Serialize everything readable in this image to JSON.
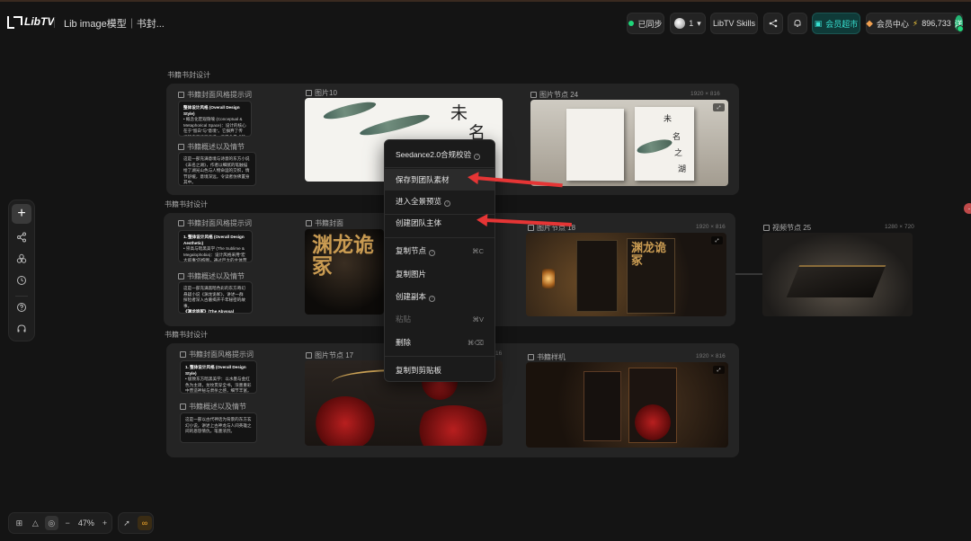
{
  "header": {
    "logo_text": "LibTV",
    "project_title": "Lib image模型｜书封...",
    "sync_label": "已同步",
    "collab_count": "1",
    "skills_label": "LibTV Skills",
    "vip_label": "会员超市",
    "member_center_label": "会员中心",
    "credits": "896,733",
    "user_initial": "洋"
  },
  "zoom": {
    "level": "47%"
  },
  "groups": [
    {
      "title": "书籍书封设计",
      "prompt_label": "书籍封面风格提示词",
      "prompt_text_title": "整体设计风格 (Overall Design Style)",
      "prompt_text_body": "• 概念化宏观隐喻 (Conceptual & Metaphorical Space)：设计的核心在于“留白”与“意境”。它摒弃了传统的直叙插画手法，采用全景式的微缩景观，营造意境。",
      "plot_label": "书籍概述以及情节",
      "plot_text": "这是一部充满意境与诗意的东方小说《未名之湖》，作者以细腻的笔触描绘了湖光山色与人物命运的交织，情节舒缓，意境深远，令读者仿佛置身其中。",
      "image_label": "图片10",
      "image_title_chars": [
        "未",
        "名"
      ],
      "node2_label": "图片节点 24",
      "node2_dim": "1920 × 816",
      "node2_chars": [
        "未",
        "名",
        "之",
        "湖"
      ]
    },
    {
      "title": "书籍书封设计",
      "prompt_label": "书籍封面风格提示词",
      "prompt_text_title": "1. 整体设计风格 (Overall Design Aesthetic)",
      "prompt_text_body": "• 崇高与暗黑美学 (The Sublime & Megalophobia)：设计风格采用“宏大叙事”的构图，通过巨大的主体营造压迫感，营造悬疑。",
      "plot_label": "书籍概述以及情节",
      "plot_text": "这是一部充满黑暗色彩的东方奇幻悬疑小说《渊龙诡冢》，讲述一群探险者深入古墓揭开千年秘密的故事。",
      "plot_text_2": "《渊龙诡冢》(The Abyssal",
      "image_label": "书籍封面",
      "image_title": "渊龙诡冢",
      "node2_label": "图片节点 18",
      "node2_dim": "1920 × 816",
      "video_label": "视频节点 25",
      "video_dim": "1280 × 720"
    },
    {
      "title": "书籍书封设计",
      "prompt_label": "书籍封面风格提示词",
      "prompt_text_title": "1. 整体设计风格 (Overall Design Style)",
      "prompt_text_body": "• 极致东方暗黑美学：以水墨与金红色为主调，龙纹贯穿全书，浓墨重彩中营造神秘与肃杀之感，细节丰富，气势磅礴。",
      "plot_label": "书籍概述以及情节",
      "plot_text": "这是一部以古代神话为背景的东方玄幻小说，讲述上古神龙与人间英雄之间的恩怨情仇，笔墨浓烈。",
      "image_label": "图片节点 17",
      "image_dim": "16",
      "node2_label": "书籍样机",
      "node2_dim": "1920 × 816"
    }
  ],
  "context_menu": {
    "items": [
      {
        "label": "Seedance2.0合规校验",
        "shortcut": "",
        "help": true,
        "disabled": false
      },
      {
        "label": "保存到团队素材",
        "shortcut": "",
        "help": false,
        "disabled": false
      },
      {
        "label": "进入全景预览",
        "shortcut": "",
        "help": true,
        "disabled": false
      },
      {
        "label": "创建团队主体",
        "shortcut": "",
        "help": false,
        "disabled": false
      },
      {
        "label": "复制节点",
        "shortcut": "⌘C",
        "help": true,
        "disabled": false
      },
      {
        "label": "复制图片",
        "shortcut": "",
        "help": false,
        "disabled": false
      },
      {
        "label": "创建副本",
        "shortcut": "",
        "help": true,
        "disabled": false
      },
      {
        "label": "粘贴",
        "shortcut": "⌘V",
        "help": false,
        "disabled": true
      },
      {
        "label": "删除",
        "shortcut": "⌘⌫",
        "help": false,
        "disabled": false
      },
      {
        "label": "复制到剪贴板",
        "shortcut": "",
        "help": false,
        "disabled": false
      }
    ]
  },
  "colors": {
    "accent_teal": "#37e0d0",
    "annotation_red": "#e53535",
    "sync_green": "#1fd67a",
    "zoom_active": "#ffb02e"
  }
}
